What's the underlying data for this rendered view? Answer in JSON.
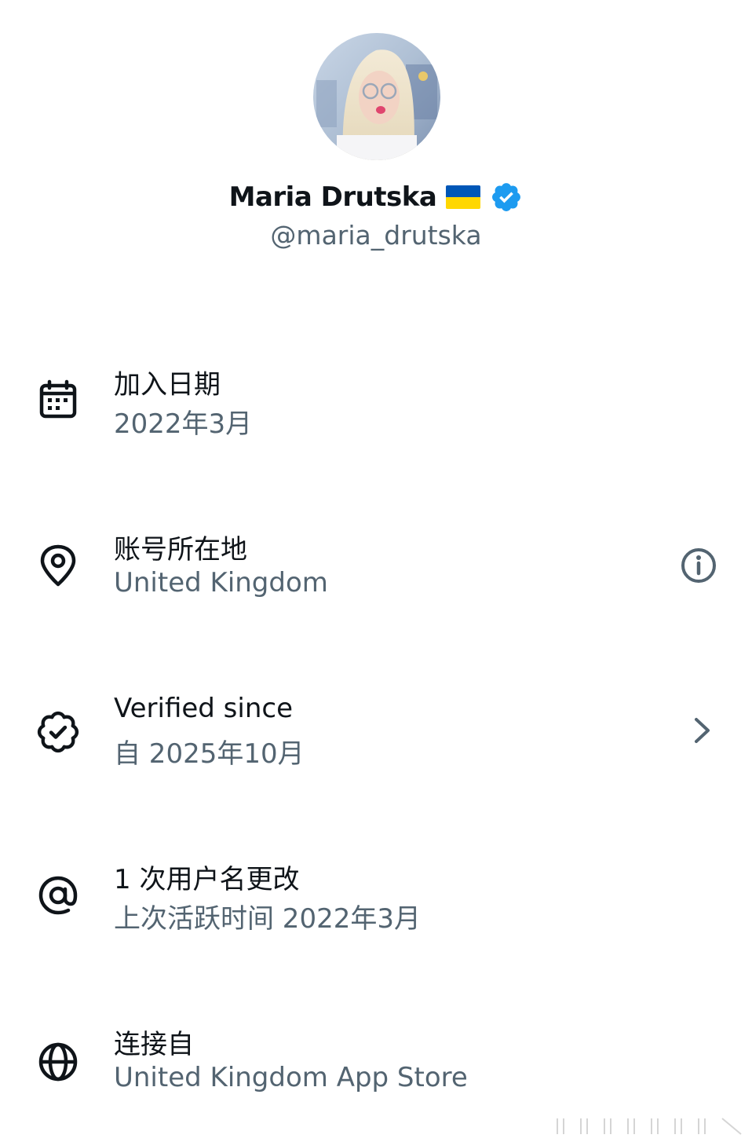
{
  "profile": {
    "display_name": "Maria Drutska",
    "handle": "@maria_drutska",
    "flag_icon": "ukraine-flag-icon",
    "badge_icon": "verified-badge-icon"
  },
  "rows": [
    {
      "icon": "calendar-icon",
      "title": "加入日期",
      "subtitle": "2022年3月"
    },
    {
      "icon": "location-pin-icon",
      "title": "账号所在地",
      "subtitle": "United Kingdom",
      "action_icon": "info-icon"
    },
    {
      "icon": "verified-outline-icon",
      "title": "Verified since",
      "subtitle": "自 2025年10月",
      "action_icon": "chevron-right-icon"
    },
    {
      "icon": "at-sign-icon",
      "title": "1 次用户名更改",
      "subtitle": "上次活跃时间 2022年3月"
    },
    {
      "icon": "globe-icon",
      "title": "连接自",
      "subtitle": "United Kingdom App Store"
    }
  ],
  "colors": {
    "primary_text": "#0f1419",
    "secondary_text": "#536471",
    "verified_blue": "#1d9bf0",
    "flag_blue": "#0057b7",
    "flag_yellow": "#ffd700"
  }
}
